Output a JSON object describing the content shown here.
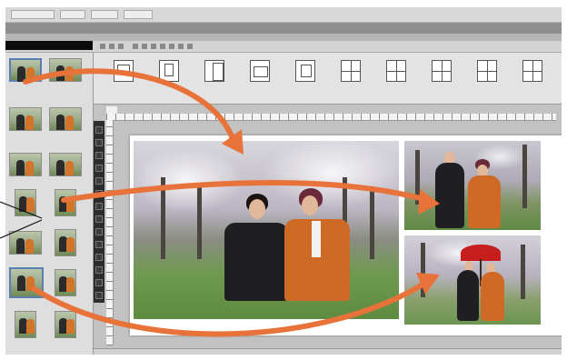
{
  "colors": {
    "arrow": "#e8733a",
    "window_bg": "#c9c9c9",
    "path_bar": "#0d0d0d",
    "selection": "#5c7fb2"
  },
  "images": {
    "main_photo": "couple-under-cherry-blossoms-photo",
    "top_right_photo": "couple-standing-among-trees-photo",
    "bottom_right_photo": "couple-with-red-umbrella-photo"
  },
  "icons": [
    "arrow-annotation-icon",
    "layout-template-icon",
    "tool-icon"
  ]
}
